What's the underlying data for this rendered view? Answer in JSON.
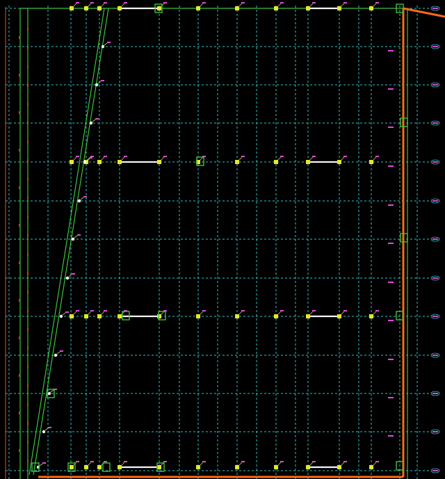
{
  "drawing": {
    "background": "#000000",
    "colors": {
      "grid": "#2fc6c6",
      "frame": "#3cc43c",
      "edge": "#ff6a1a",
      "column": "#e6e62a",
      "beam": "#f5f5f5",
      "tag": "#e04adf",
      "marker": "#d33a1f"
    }
  }
}
